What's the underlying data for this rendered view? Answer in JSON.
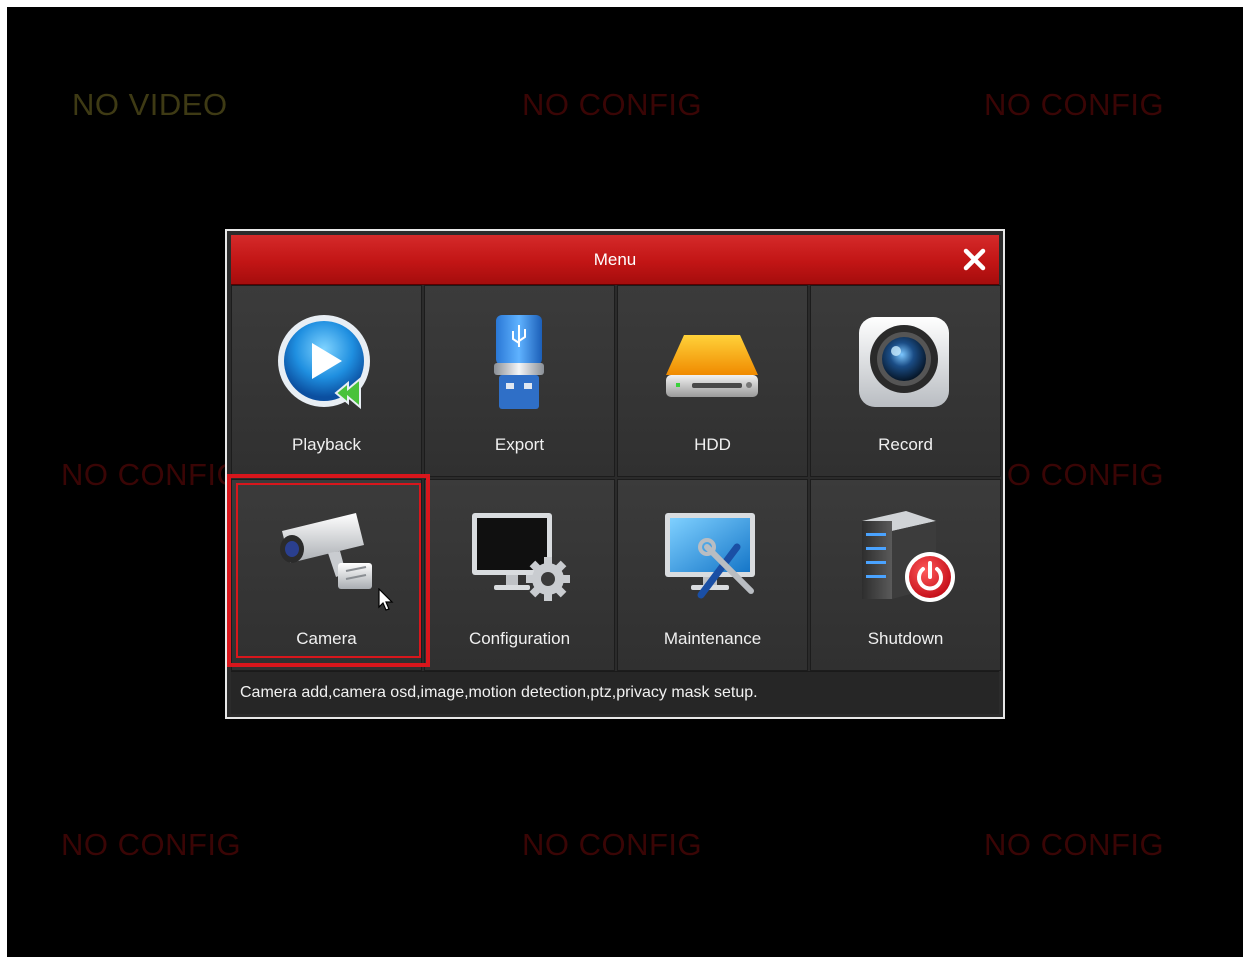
{
  "background_cells": {
    "top_left": "NO VIDEO",
    "top_center": "NO CONFIG",
    "top_right": "NO CONFIG",
    "middle_left": "NO CONFIG",
    "middle_right": "NO CONFIG",
    "bottom_left": "NO CONFIG",
    "bottom_center": "NO CONFIG",
    "bottom_right": "NO CONFIG"
  },
  "menu": {
    "title": "Menu",
    "close_icon": "close-icon",
    "items": [
      {
        "label": "Playback",
        "icon": "playback-icon"
      },
      {
        "label": "Export",
        "icon": "usb-drive-icon"
      },
      {
        "label": "HDD",
        "icon": "hard-drive-icon"
      },
      {
        "label": "Record",
        "icon": "camera-lens-icon"
      },
      {
        "label": "Camera",
        "icon": "cctv-camera-icon",
        "selected": true
      },
      {
        "label": "Configuration",
        "icon": "monitor-gear-icon"
      },
      {
        "label": "Maintenance",
        "icon": "monitor-tools-icon"
      },
      {
        "label": "Shutdown",
        "icon": "server-power-icon"
      }
    ],
    "status": "Camera add,camera osd,image,motion detection,ptz,privacy mask setup."
  },
  "colors": {
    "accent": "#c41a1a",
    "highlight": "#d8161c",
    "no_video_text": "#3e3a14",
    "no_config_text": "#3a0505"
  }
}
